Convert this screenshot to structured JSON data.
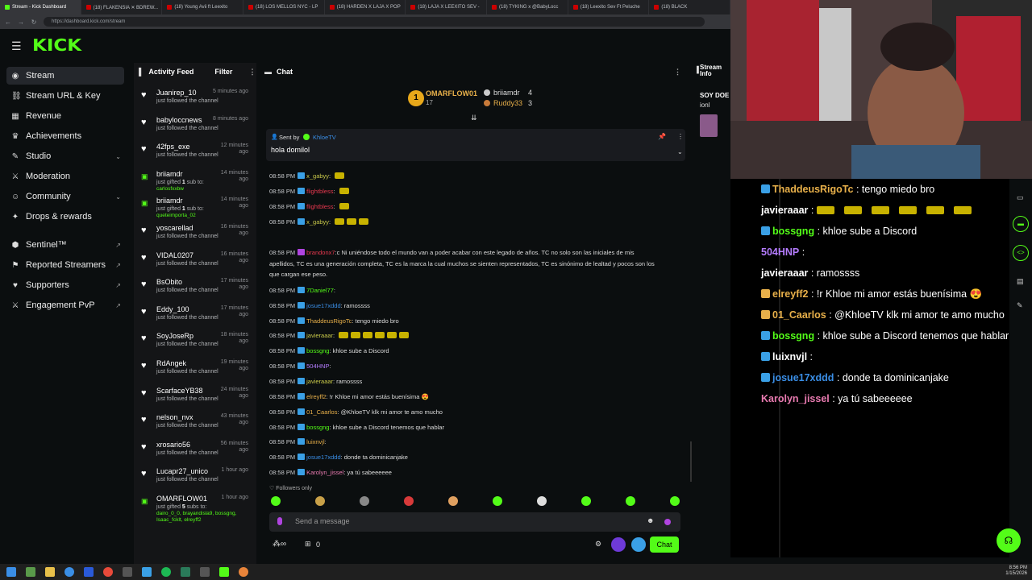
{
  "browser": {
    "tabs": [
      {
        "label": "Stream - Kick Dashboard",
        "active": true
      },
      {
        "label": "(18) FLAKENSIA ✕ BDREW..."
      },
      {
        "label": "(18) Young Avii ft Leexito"
      },
      {
        "label": "(18) LOS MELLOS NYC - LP"
      },
      {
        "label": "(18) HARDEN X LAJA X POP"
      },
      {
        "label": "(18) LAJA X LEEXITO SEV -"
      },
      {
        "label": "(18) TYKING x @BabyLocc"
      },
      {
        "label": "(18) Leexito Sev Ft Peluche"
      },
      {
        "label": "(18) BLACK"
      }
    ],
    "url": "https://dashboard.kick.com/stream"
  },
  "header": {
    "logo": "KICK"
  },
  "sidebar": {
    "items": [
      {
        "label": "Stream",
        "icon": "radio-icon",
        "active": true
      },
      {
        "label": "Stream URL & Key",
        "icon": "link-icon"
      },
      {
        "label": "Revenue",
        "icon": "revenue-icon"
      },
      {
        "label": "Achievements",
        "icon": "trophy-icon"
      },
      {
        "label": "Studio",
        "icon": "palette-icon",
        "expand": true
      },
      {
        "label": "Moderation",
        "icon": "sword-icon"
      },
      {
        "label": "Community",
        "icon": "people-icon",
        "expand": true
      },
      {
        "label": "Drops & rewards",
        "icon": "gift-icon"
      },
      {
        "label": "Sentinel™",
        "icon": "shield-icon",
        "external": true
      },
      {
        "label": "Reported Streamers",
        "icon": "flag-icon",
        "external": true
      },
      {
        "label": "Supporters",
        "icon": "heart-icon",
        "external": true
      },
      {
        "label": "Engagement PvP",
        "icon": "swords-icon",
        "external": true
      }
    ]
  },
  "feed": {
    "title": "Activity Feed",
    "filter": "Filter",
    "items": [
      {
        "type": "follow",
        "name": "Juanirep_10",
        "time": "5 minutes ago",
        "desc": "just followed the channel"
      },
      {
        "type": "follow",
        "name": "babyloccnews",
        "time": "8 minutes ago",
        "desc": "just followed the channel"
      },
      {
        "type": "follow",
        "name": "42fps_exe",
        "time": "12 minutes ago",
        "desc": "just followed the channel"
      },
      {
        "type": "gift",
        "name": "briiamdr",
        "time": "14 minutes ago",
        "desc_pre": "just gifted ",
        "desc_num": "1",
        "desc_post": " sub to:",
        "recipients": "carlosfxxbw"
      },
      {
        "type": "gift",
        "name": "briiamdr",
        "time": "14 minutes ago",
        "desc_pre": "just gifted ",
        "desc_num": "1",
        "desc_post": " sub to:",
        "recipients": "queteimporta_02"
      },
      {
        "type": "follow",
        "name": "yoscarellad",
        "time": "16 minutes ago",
        "desc": "just followed the channel"
      },
      {
        "type": "follow",
        "name": "VIDAL0207",
        "time": "16 minutes ago",
        "desc": "just followed the channel"
      },
      {
        "type": "follow",
        "name": "BsObito",
        "time": "17 minutes ago",
        "desc": "just followed the channel"
      },
      {
        "type": "follow",
        "name": "Eddy_100",
        "time": "17 minutes ago",
        "desc": "just followed the channel"
      },
      {
        "type": "follow",
        "name": "SoyJoseRp",
        "time": "18 minutes ago",
        "desc": "just followed the channel"
      },
      {
        "type": "follow",
        "name": "RdAngek",
        "time": "19 minutes ago",
        "desc": "just followed the channel"
      },
      {
        "type": "follow",
        "name": "ScarfaceYB38",
        "time": "24 minutes ago",
        "desc": "just followed the channel"
      },
      {
        "type": "follow",
        "name": "nelson_nvx",
        "time": "43 minutes ago",
        "desc": "just followed the channel"
      },
      {
        "type": "follow",
        "name": "xrosario56",
        "time": "56 minutes ago",
        "desc": "just followed the channel"
      },
      {
        "type": "follow",
        "name": "Lucapr27_unico",
        "time": "1 hour ago",
        "desc": "just followed the channel"
      },
      {
        "type": "gift",
        "name": "OMARFLOW01",
        "time": "1 hour ago",
        "desc_pre": "just gifted ",
        "desc_num": "5",
        "desc_post": " subs to:",
        "recipients": "dairo_0_0, brayandisla9, bossgng, Isaac_fcklt, elreyff2"
      }
    ]
  },
  "chat": {
    "title": "Chat",
    "leaderboard": {
      "first": {
        "name": "OMARFLOW01",
        "count": "17"
      },
      "second": {
        "name": "briiamdr",
        "count": "4"
      },
      "third": {
        "name": "Ruddy33",
        "count": "3"
      }
    },
    "pinned": {
      "sent_by": "Sent by",
      "author": "KhloeTV",
      "message": "hola domilol"
    },
    "messages": [
      {
        "time": "08:58 PM",
        "user": "x_gabyy",
        "color": "#c9c94a",
        "sep": ":",
        "text": "",
        "emotes": 1
      },
      {
        "time": "08:58 PM",
        "user": "flightbless",
        "color": "#e8384f",
        "sep": ":",
        "text": "",
        "emotes": 1
      },
      {
        "time": "08:58 PM",
        "user": "flightbless",
        "color": "#e8384f",
        "sep": ":",
        "text": "",
        "emotes": 1
      },
      {
        "time": "08:58 PM",
        "user": "x_gabyy",
        "color": "#c9c94a",
        "sep": ":",
        "text": "",
        "emotes": 3
      }
    ],
    "long_message": {
      "time": "08:58 PM",
      "user": "brandonx7",
      "color": "#e8384f",
      "text": ":c Ni uniéndose todo el mundo van a poder acabar con este legado de   años. TC no solo son las iniciales de mis apellidos, TC es una generación completa, TC es la marca la cual muchos se sienten representados, TC es sinónimo de lealtad y pocos son los que cargan ese peso."
    },
    "messages2": [
      {
        "time": "08:58 PM",
        "user": "7Daniel77",
        "color": "#53fc18",
        "sep": ":",
        "text": "",
        "emotes": 0
      },
      {
        "time": "08:58 PM",
        "user": "josue17xddd",
        "color": "#3a8ee6",
        "sep": ":",
        "text": "ramossss",
        "emotes": 0
      },
      {
        "time": "08:58 PM",
        "user": "ThaddeusRigoTc",
        "color": "#e8b04a",
        "sep": ":",
        "text": "tengo miedo bro",
        "emotes": 0
      },
      {
        "time": "08:58 PM",
        "user": "javieraaar",
        "color": "#c9c94a",
        "sep": ":",
        "text": "",
        "emotes": 6
      },
      {
        "time": "08:58 PM",
        "user": "bossgng",
        "color": "#53fc18",
        "sep": ":",
        "text": "khloe sube a Discord",
        "emotes": 0
      },
      {
        "time": "08:58 PM",
        "user": "504HNP",
        "color": "#b57cff",
        "sep": ":",
        "text": "",
        "emotes": 0
      },
      {
        "time": "08:58 PM",
        "user": "javieraaar",
        "color": "#c9c94a",
        "sep": ":",
        "text": "ramossss",
        "emotes": 0
      },
      {
        "time": "08:58 PM",
        "user": "elreyff2",
        "color": "#e8b04a",
        "sep": ":",
        "text": "!r Khloe mi amor estás buenísima 😍",
        "emotes": 0
      },
      {
        "time": "08:58 PM",
        "user": "01_Caarlos",
        "color": "#e8b04a",
        "sep": ":",
        "text": "@KhloeTV klk mi amor te amo mucho",
        "emotes": 0
      },
      {
        "time": "08:58 PM",
        "user": "bossgng",
        "color": "#53fc18",
        "sep": ":",
        "text": "khloe sube a Discord tenemos que hablar",
        "emotes": 0
      },
      {
        "time": "08:58 PM",
        "user": "luixnvjl",
        "color": "#e8b04a",
        "sep": ":",
        "text": "",
        "emotes": 0
      },
      {
        "time": "08:58 PM",
        "user": "josue17xddd",
        "color": "#3a8ee6",
        "sep": ":",
        "text": "donde ta dominicanjake",
        "emotes": 0
      },
      {
        "time": "08:58 PM",
        "user": "Karolyn_jissel",
        "color": "#e87ab0",
        "sep": ":",
        "text": "ya tú sabeeeeee",
        "emotes": 0
      }
    ],
    "followers_only": "Followers only",
    "input_placeholder": "Send a message",
    "chat_button": "Chat",
    "bottom_count": "0"
  },
  "stream_info": {
    "label": "Stream Info",
    "title": "SOY DOE",
    "line2": "ionl"
  },
  "overlay": {
    "lines": [
      {
        "user": "ThaddeusRigoTc",
        "color": "#e8b04a",
        "text": " : tengo miedo bro"
      },
      {
        "user": "javieraaar",
        "color": "#ffffff",
        "text": " : "
      },
      {
        "user": "bossgng",
        "color": "#53fc18",
        "text": " : khloe sube a Discord"
      },
      {
        "user": "504HNP",
        "color": "#b57cff",
        "text": " : "
      },
      {
        "user": "javieraaar",
        "color": "#ffffff",
        "text": " : ramossss"
      },
      {
        "user": "elreyff2",
        "color": "#e8b04a",
        "text": " : !r Khloe mi amor estás buenísima 😍"
      },
      {
        "user": "01_Caarlos",
        "color": "#e8b04a",
        "text": " : @KhloeTV klk mi amor te amo mucho"
      },
      {
        "user": "bossgng",
        "color": "#53fc18",
        "text": " : khloe sube a Discord tenemos que hablar"
      },
      {
        "user": "luixnvjl",
        "color": "#ffffff",
        "text": " : "
      },
      {
        "user": "josue17xddd",
        "color": "#3a8ee6",
        "text": " : donde ta dominicanjake"
      },
      {
        "user": "Karolyn_jissel",
        "color": "#e87ab0",
        "text": " : ya tú sabeeeeee"
      }
    ]
  },
  "taskbar": {
    "time": "8:56 PM",
    "date": "1/15/2026"
  },
  "colors": {
    "brand": "#53fc18",
    "bg": "#0b0e0f",
    "panel": "#141517"
  }
}
